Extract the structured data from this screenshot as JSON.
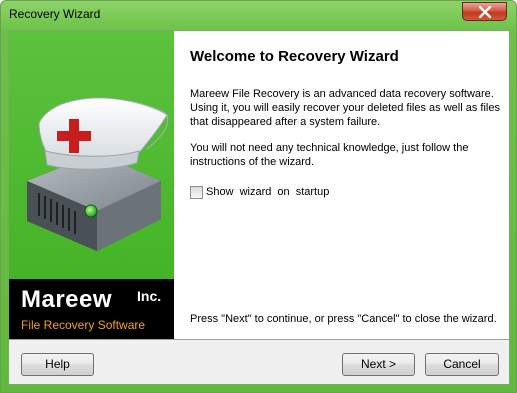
{
  "window": {
    "title": "Recovery Wizard"
  },
  "logo": {
    "company": "Mareew",
    "suffix": "Inc.",
    "tagline": "File Recovery Software"
  },
  "content": {
    "heading": "Welcome to Recovery Wizard",
    "paragraph1": "Mareew File Recovery is an advanced data recovery software. Using it, you will easily recover your deleted files as well as files that disappeared after a system failure.",
    "paragraph2": "You will not need any technical knowledge, just follow the instructions of the wizard.",
    "startup_checkbox": {
      "label": "Show wizard on startup",
      "checked": false
    },
    "hint": "Press \"Next\" to continue, or press \"Cancel\" to close the wizard."
  },
  "buttons": {
    "help": "Help",
    "next": "Next >",
    "cancel": "Cancel"
  },
  "colors": {
    "side_panel_green": "#4cb82f",
    "logo_tagline_orange": "#f0a020",
    "close_button_red": "#c84a32"
  }
}
